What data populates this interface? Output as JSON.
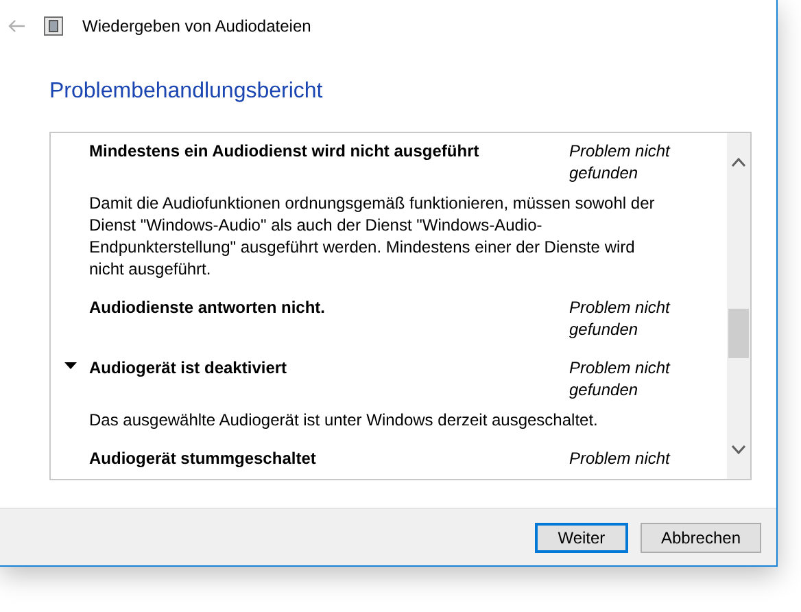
{
  "window": {
    "title": "Wiedergeben von Audiodateien"
  },
  "heading": "Problembehandlungsbericht",
  "report_items": [
    {
      "title": "Mindestens ein Audiodienst wird nicht ausgeführt",
      "status": "Problem nicht gefunden",
      "selected": false,
      "description": "Damit die Audiofunktionen ordnungsgemäß funktionieren, müssen sowohl der Dienst \"Windows-Audio\" als auch der Dienst \"Windows-Audio-Endpunkterstellung\" ausgeführt werden. Mindestens einer der Dienste wird nicht ausgeführt."
    },
    {
      "title": "Audiodienste antworten nicht.",
      "status": "Problem nicht gefunden",
      "selected": false
    },
    {
      "title": "Audiogerät ist deaktiviert",
      "status": "Problem nicht gefunden",
      "selected": true,
      "description": "Das ausgewählte Audiogerät ist unter Windows derzeit ausgeschaltet."
    },
    {
      "title": "Audiogerät stummgeschaltet",
      "status": "Problem nicht",
      "selected": false
    }
  ],
  "buttons": [
    {
      "label": "Weiter",
      "default": true
    },
    {
      "label": "Abbrechen",
      "default": false
    }
  ]
}
